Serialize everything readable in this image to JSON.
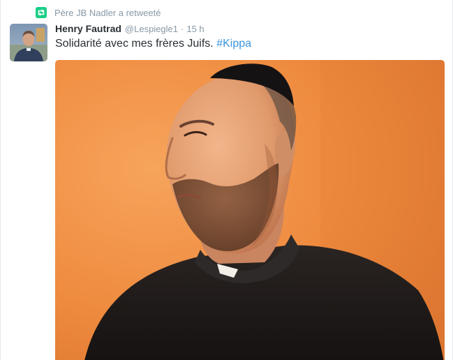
{
  "retweet": {
    "text": "Père JB Nadler a retweeté",
    "icon": "retweet-icon",
    "color": "#19cf86"
  },
  "tweet": {
    "author": {
      "fullname": "Henry Fautrad",
      "username": "@Lespiegle1"
    },
    "separator": "·",
    "time": "15 h",
    "text": "Solidarité avec mes frères Juifs.",
    "hashtag": "#Kippa"
  },
  "colors": {
    "name": "#292f33",
    "meta": "#8899a6",
    "hashtag": "#3b94d9",
    "retweet_green": "#19cf86"
  }
}
